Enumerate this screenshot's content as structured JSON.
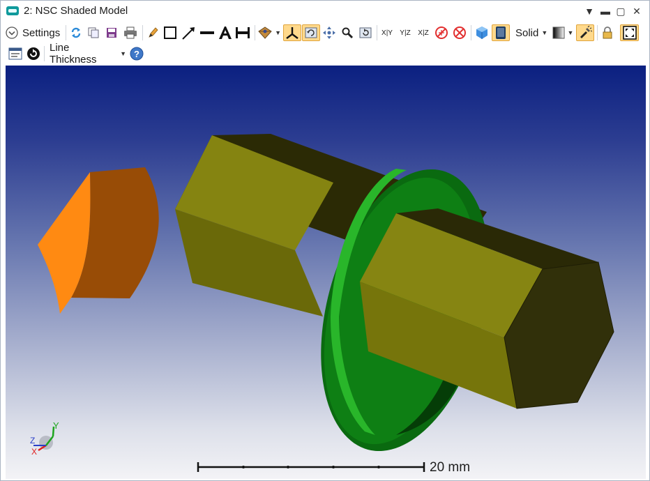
{
  "window": {
    "title": "2: NSC Shaded Model"
  },
  "toolbar": {
    "settings_label": "Settings",
    "solid_label": "Solid",
    "line_thickness_label": "Line Thickness",
    "tools_row1": [
      "refresh-icon",
      "copy-icon",
      "save-icon",
      "print-icon",
      "pencil-icon",
      "rectangle-icon",
      "arrow-line-icon",
      "line-icon",
      "text-tool-icon",
      "dimension-icon",
      "layout-icon",
      "axes-icon",
      "rotate-view-icon",
      "pan-icon",
      "zoom-icon",
      "reset-view-icon",
      "view-xy-icon",
      "view-yz-icon",
      "view-xz-icon",
      "hide-rays-icon",
      "clear-rays-icon",
      "cube-icon",
      "shaded-icon",
      "gradient-icon",
      "lightbulb-icon",
      "lock-icon",
      "fit-view-icon"
    ],
    "tools_row2": [
      "window-icon",
      "sync-icon",
      "help-icon"
    ],
    "view_labels": [
      "X|Y",
      "Y|Z",
      "X|Z"
    ]
  },
  "viewport": {
    "background_top": "#0b2081",
    "background_bottom": "#f3f3f6",
    "objects": [
      "lens-orange",
      "hex-rod-yellow",
      "disk-green"
    ],
    "colors": {
      "lens": "#ff8a12",
      "rod": "#7f7e0c",
      "disk": "#0a7a10"
    },
    "axis_labels": {
      "x": "X",
      "y": "Y",
      "z": "Z"
    },
    "scale_bar": {
      "label": "20 mm",
      "ticks": 6
    }
  }
}
